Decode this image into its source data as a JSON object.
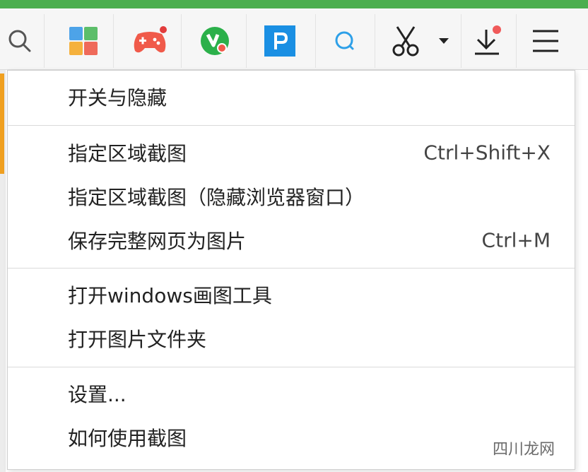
{
  "toolbar": {
    "icons": [
      "search-icon",
      "app-grid-icon",
      "gamepad-icon",
      "green-y-icon",
      "p-icon",
      "browse-search-icon",
      "scissors-icon",
      "caret-down-icon",
      "download-icon",
      "hamburger-menu-icon"
    ],
    "colors": {
      "accent_green": "#4cae4f",
      "notification_red": "#e23c3c",
      "blue": "#1a8fe3"
    }
  },
  "menu": {
    "sections": [
      {
        "items": [
          {
            "label": "开关与隐藏",
            "shortcut": ""
          }
        ]
      },
      {
        "items": [
          {
            "label": "指定区域截图",
            "shortcut": "Ctrl+Shift+X"
          },
          {
            "label": "指定区域截图（隐藏浏览器窗口）",
            "shortcut": ""
          },
          {
            "label": "保存完整网页为图片",
            "shortcut": "Ctrl+M"
          }
        ]
      },
      {
        "items": [
          {
            "label": "打开windows画图工具",
            "shortcut": ""
          },
          {
            "label": "打开图片文件夹",
            "shortcut": ""
          }
        ]
      },
      {
        "items": [
          {
            "label": "设置...",
            "shortcut": ""
          },
          {
            "label": "如何使用截图",
            "shortcut": ""
          }
        ]
      }
    ]
  },
  "watermark": "四川龙网"
}
